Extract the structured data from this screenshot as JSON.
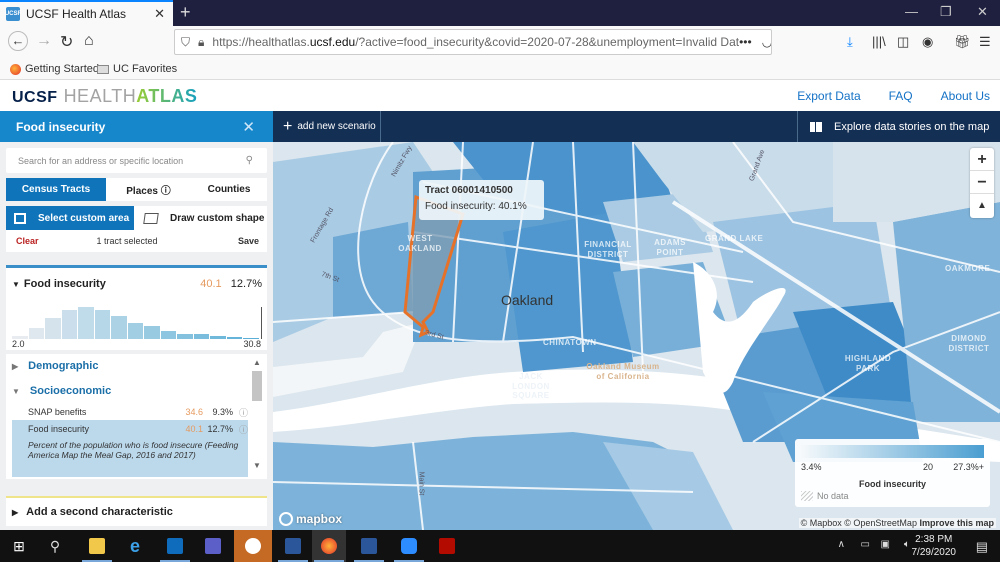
{
  "browser": {
    "tab_title": "UCSF Health Atlas",
    "url_prefix": "https://healthatlas.",
    "url_domain": "ucsf.edu",
    "url_rest": "/?active=food_insecurity&covid=2020-07-28&unemployment=Invalid Dat",
    "bookmarks": [
      "Getting Started",
      "UC Favorites"
    ]
  },
  "app": {
    "logo_ucsf": "UCSF",
    "logo_health": "HEALTH",
    "logo_atlas": "ATLAS",
    "nav": [
      "Export Data",
      "FAQ",
      "About Us"
    ]
  },
  "panel": {
    "title": "Food insecurity",
    "close": "✕",
    "search_placeholder": "Search for an address or specific location",
    "geo_tabs": [
      {
        "label": "Census Tracts",
        "active": true
      },
      {
        "label": "Places ⓘ",
        "active": false
      },
      {
        "label": "Counties",
        "active": false
      }
    ],
    "select_custom_area": "Select custom area",
    "draw_custom_shape": "Draw custom shape",
    "clear": "Clear",
    "selection_count": "1 tract selected",
    "save": "Save",
    "variable": {
      "name": "Food insecurity",
      "selected_value": "40.1",
      "average": "12.7%",
      "hist_min": "2.0",
      "hist_max": "30.8",
      "histogram": [
        1,
        4,
        8,
        11,
        12,
        11,
        8.5,
        6,
        5,
        3,
        2,
        2,
        1,
        0.6,
        0.3
      ]
    },
    "categories": [
      {
        "label": "Demographic",
        "expanded": false
      },
      {
        "label": "Socioeconomic",
        "expanded": true
      }
    ],
    "rows": [
      {
        "label": "SNAP benefits",
        "value": "34.6",
        "avg": "9.3%"
      },
      {
        "label": "Food insecurity",
        "value": "40.1",
        "avg": "12.7%"
      }
    ],
    "description": "Percent of the population who is food insecure (Feeding America Map the Meal Gap, 2016 and 2017)",
    "add_second": "Add a second characteristic"
  },
  "scenario": {
    "add": "add new scenario",
    "explore": "Explore data stories on the map"
  },
  "map": {
    "tooltip_title": "Tract 06001410500",
    "tooltip_value": "Food insecurity: 40.1%",
    "city_label": "Oakland",
    "places": [
      "WEST OAKLAND",
      "FINANCIAL DISTRICT",
      "ADAMS POINT",
      "GRAND LAKE",
      "CHINATOWN",
      "JACK LONDON SQUARE",
      "Oakland Museum of California",
      "OAKMORE",
      "DIMOND DISTRICT",
      "HIGHLAND PARK"
    ],
    "streets": [
      "Frontage Rd",
      "7th St",
      "3rd St",
      "Nimitz Fwy",
      "Grand Ave",
      "Main St"
    ],
    "zoom_in": "+",
    "zoom_out": "−",
    "compass": "▲",
    "legend": {
      "min": "3.4%",
      "mid": "20",
      "max": "27.3%+",
      "title": "Food insecurity",
      "nodata": "No data",
      "color_low": "#f6f9fb",
      "color_high": "#4a9ed1"
    },
    "attribution": "© Mapbox © OpenStreetMap",
    "improve": "Improve this map",
    "mapbox_logo": "mapbox"
  },
  "taskbar": {
    "time": "2:38 PM",
    "date": "7/29/2020"
  }
}
